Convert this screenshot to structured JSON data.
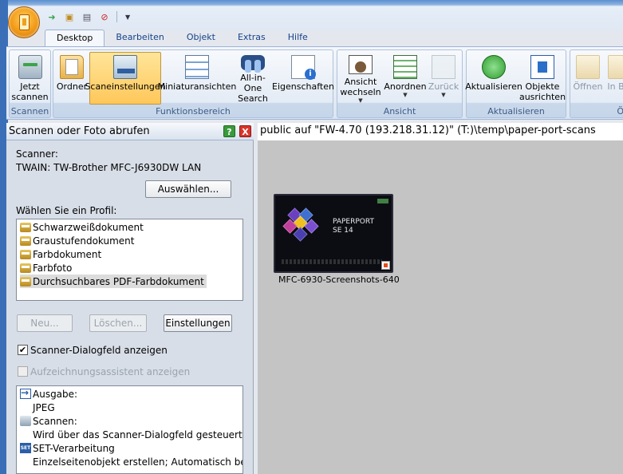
{
  "ribbon": {
    "tabs": [
      "Desktop",
      "Bearbeiten",
      "Objekt",
      "Extras",
      "Hilfe"
    ],
    "active_tab": "Desktop",
    "groups": {
      "scannen": {
        "label": "Scannen",
        "buttons": [
          {
            "label": "Jetzt scannen",
            "icon": "scanner-icon"
          }
        ]
      },
      "funktion": {
        "label": "Funktionsbereich",
        "buttons": [
          {
            "label": "Ordner",
            "icon": "folder-icon"
          },
          {
            "label": "Scaneinstellungen",
            "icon": "scan-settings-icon",
            "active": true
          },
          {
            "label": "Miniaturansichten",
            "icon": "thumbnails-icon"
          },
          {
            "label": "All-in-One Search",
            "icon": "binoculars-icon"
          },
          {
            "label": "Eigenschaften",
            "icon": "properties-icon"
          }
        ]
      },
      "ansicht": {
        "label": "Ansicht",
        "buttons": [
          {
            "label": "Ansicht wechseln",
            "icon": "view-icon",
            "dropdown": true
          },
          {
            "label": "Anordnen",
            "icon": "arrange-icon",
            "dropdown": true
          },
          {
            "label": "Zurück",
            "icon": "back-icon",
            "dropdown": true,
            "disabled": true
          }
        ]
      },
      "aktualisieren": {
        "label": "Aktualisieren",
        "buttons": [
          {
            "label": "Aktualisieren",
            "icon": "refresh-icon"
          },
          {
            "label": "Objekte ausrichten",
            "icon": "align-objects-icon"
          }
        ]
      },
      "partial": {
        "buttons": [
          {
            "label": "Öffnen",
            "icon": "open-icon",
            "disabled": true
          },
          {
            "label": "In B",
            "icon": "open-icon",
            "disabled": true
          }
        ],
        "label": "Ö"
      }
    }
  },
  "panel": {
    "title": "Scannen oder Foto abrufen",
    "scanner_label": "Scanner:",
    "scanner_name": "TWAIN: TW-Brother MFC-J6930DW LAN",
    "select_button": "Auswählen...",
    "profile_label": "Wählen Sie ein Profil:",
    "profiles": [
      "Schwarzweißdokument",
      "Graustufendokument",
      "Farbdokument",
      "Farbfoto",
      "Durchsuchbares PDF-Farbdokument"
    ],
    "selected_profile_index": 4,
    "new_button": "Neu...",
    "delete_button": "Löschen...",
    "settings_button": "Einstellungen",
    "show_dialog": {
      "label": "Scanner-Dialogfeld anzeigen",
      "checked": true
    },
    "assistant": {
      "label": "Aufzeichnungsassistent anzeigen",
      "checked": false,
      "disabled": true
    },
    "output_lines": [
      {
        "icon": "output-arrow-icon",
        "text": "Ausgabe:"
      },
      {
        "icon": "",
        "text": "JPEG"
      },
      {
        "icon": "scanner-icon",
        "text": "Scannen:"
      },
      {
        "icon": "",
        "text": "Wird über das Scanner-Dialogfeld gesteuert"
      },
      {
        "icon": "set-icon",
        "text": "SET-Verarbeitung"
      },
      {
        "icon": "",
        "text": "Einzelseitenobjekt erstellen; Automatisch begra"
      }
    ]
  },
  "content": {
    "path": "public auf \"FW-4.70 (193.218.31.12)\" (T:)\\temp\\paper-port-scans",
    "items": [
      {
        "caption": "MFC-6930-Screenshots-640",
        "thumb_title": "PAPERPORT\nSE 14"
      }
    ]
  }
}
